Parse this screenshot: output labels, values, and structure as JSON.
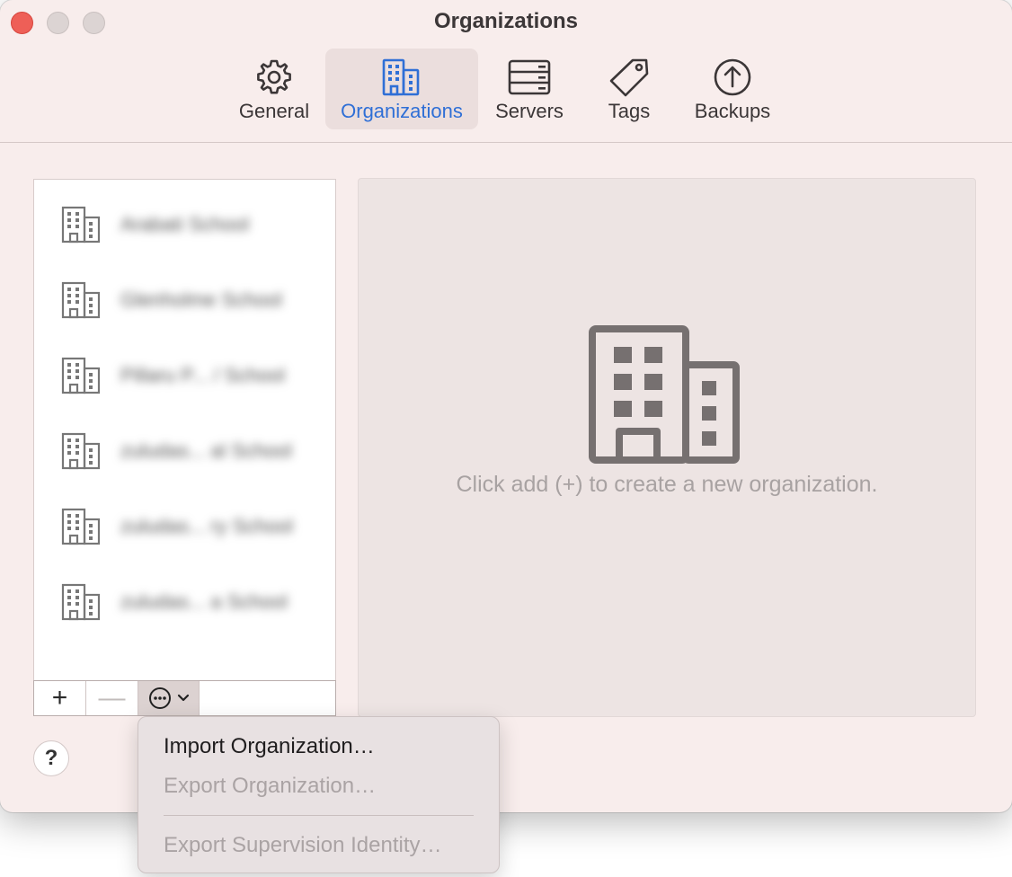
{
  "window": {
    "title": "Organizations"
  },
  "toolbar": {
    "tabs": [
      {
        "label": "General",
        "icon": "gear-icon"
      },
      {
        "label": "Organizations",
        "icon": "buildings-icon",
        "active": true
      },
      {
        "label": "Servers",
        "icon": "server-icon"
      },
      {
        "label": "Tags",
        "icon": "tag-icon"
      },
      {
        "label": "Backups",
        "icon": "upload-arrow-icon"
      }
    ]
  },
  "organizations": {
    "items": [
      {
        "name": "Arabati School"
      },
      {
        "name": "Glenholme School"
      },
      {
        "name": "Pillaru P... / School"
      },
      {
        "name": "zuludas... al School"
      },
      {
        "name": "zuludas... ry School"
      },
      {
        "name": "zuludas... a School"
      }
    ],
    "add_label": "+",
    "remove_label": "—"
  },
  "detail": {
    "empty_hint": "Click add (+) to create a new organization."
  },
  "help": {
    "label": "?"
  },
  "menu": {
    "items": [
      {
        "label": "Import Organization…",
        "enabled": true
      },
      {
        "label": "Export Organization…",
        "enabled": false
      },
      {
        "label": "Export Supervision Identity…",
        "enabled": false
      }
    ]
  },
  "colors": {
    "accent": "#2f6fd6",
    "window_bg": "#f8edec",
    "close": "#ee5f57"
  }
}
